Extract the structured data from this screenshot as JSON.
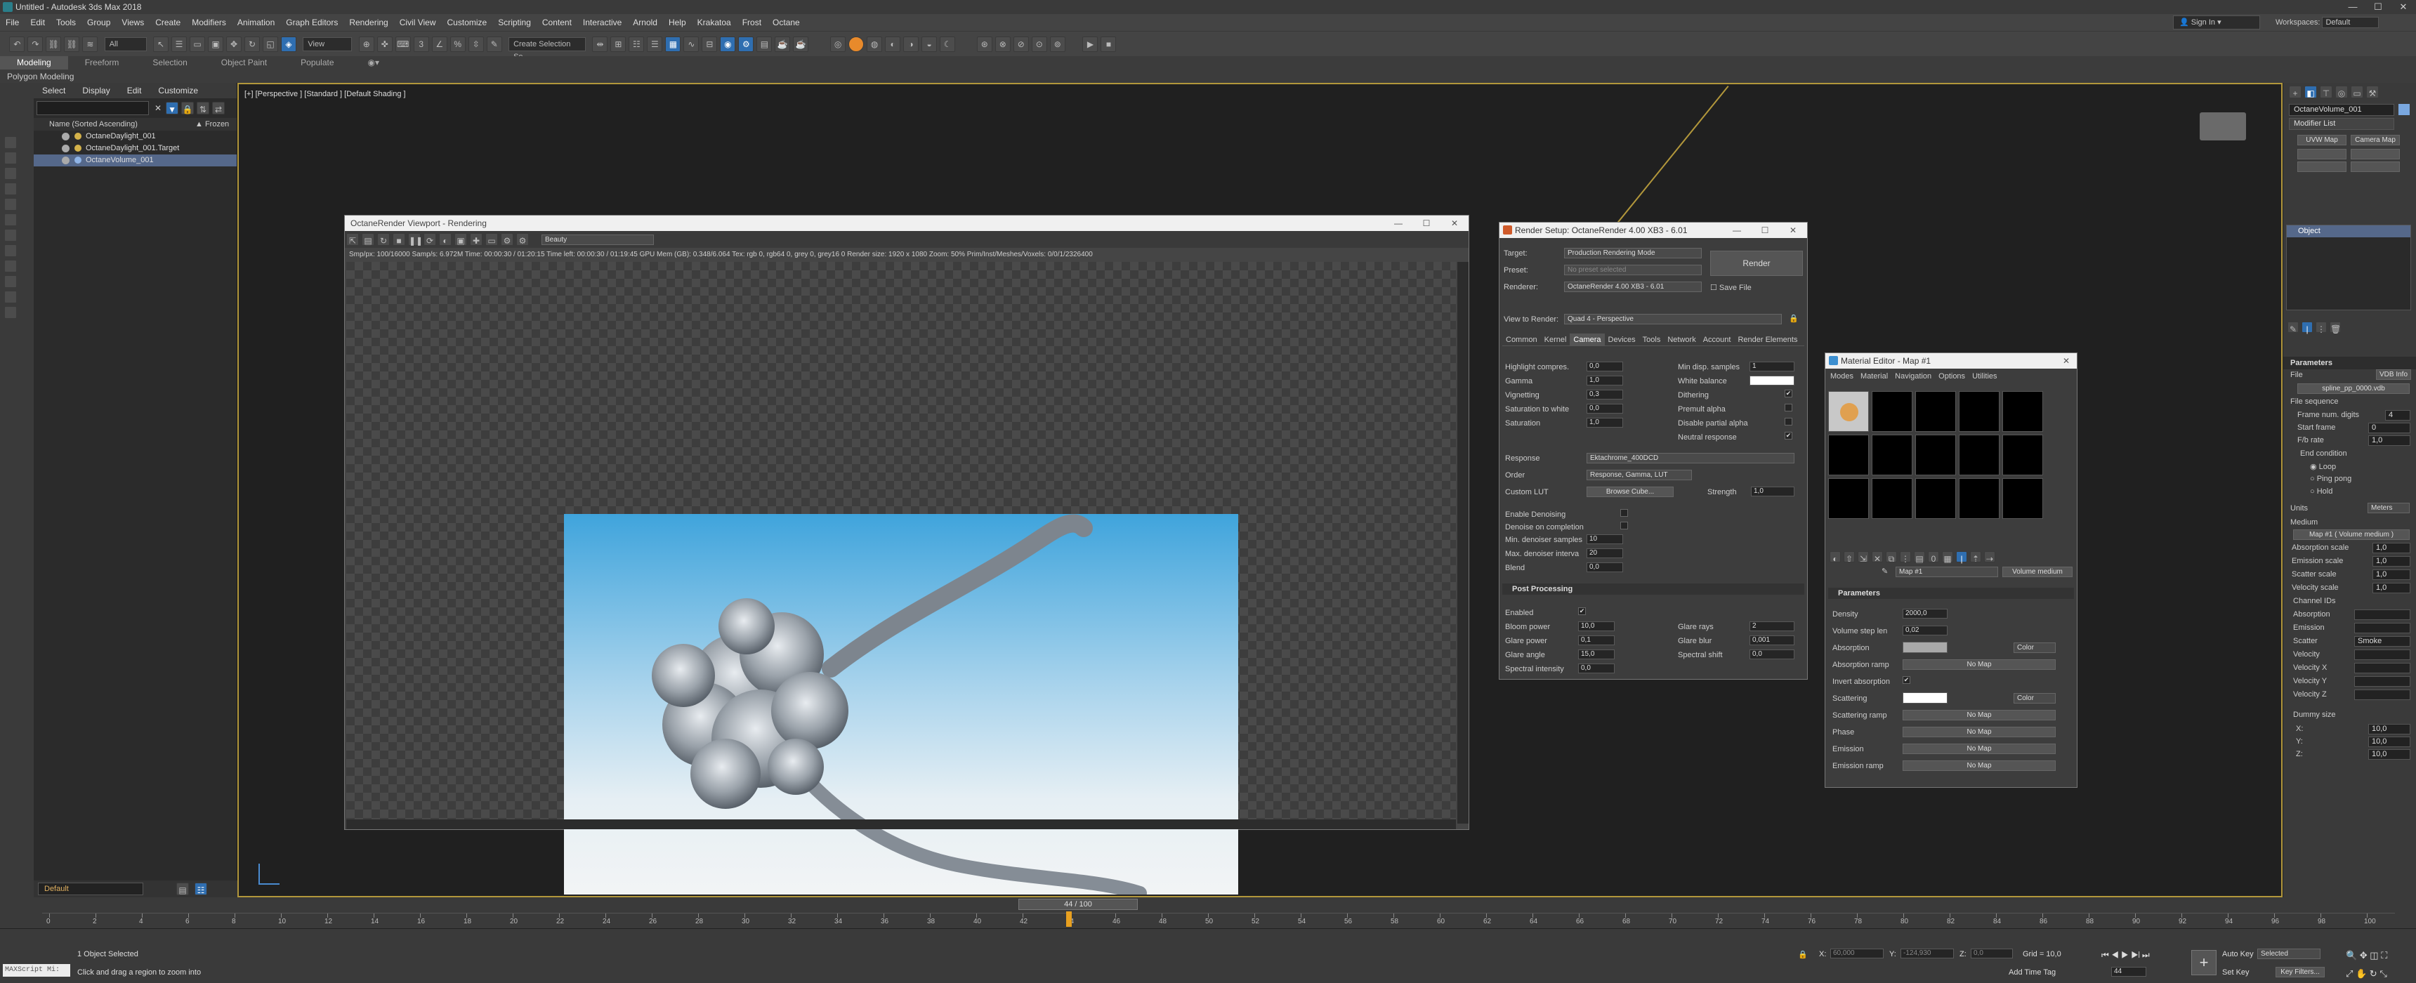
{
  "titlebar": {
    "title": "Untitled - Autodesk 3ds Max 2018",
    "signin": "Sign In",
    "workspace_label": "Workspaces:",
    "workspace": "Default"
  },
  "menus": [
    "File",
    "Edit",
    "Tools",
    "Group",
    "Views",
    "Create",
    "Modifiers",
    "Animation",
    "Graph Editors",
    "Rendering",
    "Civil View",
    "Customize",
    "Scripting",
    "Content",
    "Interactive",
    "Arnold",
    "Help",
    "Krakatoa",
    "Frost",
    "Octane"
  ],
  "toolbar": {
    "filter": "All",
    "refcoord": "View",
    "selset": "Create Selection Se"
  },
  "ribbon": {
    "tabs": [
      "Modeling",
      "Freeform",
      "Selection",
      "Object Paint",
      "Populate"
    ],
    "sub": "Polygon Modeling"
  },
  "scene_explorer": {
    "tabs": [
      "Select",
      "Display",
      "Edit",
      "Customize"
    ],
    "header": "Name (Sorted Ascending)",
    "frozen": "▲ Frozen",
    "rows": [
      "OctaneDaylight_001",
      "OctaneDaylight_001.Target",
      "OctaneVolume_001"
    ],
    "layer": "Default"
  },
  "viewport": {
    "label": "[+] [Perspective ] [Standard ] [Default Shading ]"
  },
  "octane_viewport": {
    "title": "OctaneRender Viewport - Rendering",
    "pass": "Beauty",
    "stats": "Smp/px: 100/16000   Samp/s: 6.972M   Time: 00:00:30 / 01:20:15   Time left: 00:00:30 / 01:19:45   GPU Mem (GB): 0.348/6.064   Tex: rgb 0, rgb64 0, grey 0, grey16 0   Render size: 1920 x 1080   Zoom: 50%   Prim/Inst/Meshes/Voxels: 0/0/1/2326400"
  },
  "render_setup": {
    "title": "Render Setup: OctaneRender 4.00 XB3 - 6.01",
    "target_label": "Target:",
    "target": "Production Rendering Mode",
    "preset_label": "Preset:",
    "preset": "No preset selected",
    "renderer_label": "Renderer:",
    "renderer": "OctaneRender 4.00 XB3 - 6.01",
    "save_file": "Save File",
    "view_label": "View to Render:",
    "view": "Quad 4 - Perspective",
    "render_btn": "Render",
    "tabs": [
      "Common",
      "Kernel",
      "Camera",
      "Devices",
      "Tools",
      "Network",
      "Account",
      "Render Elements"
    ],
    "left_fields": [
      {
        "l": "Highlight compres.",
        "v": "0,0"
      },
      {
        "l": "Gamma",
        "v": "1,0"
      },
      {
        "l": "Vignetting",
        "v": "0,3"
      },
      {
        "l": "Saturation to white",
        "v": "0,0"
      },
      {
        "l": "Saturation",
        "v": "1,0"
      }
    ],
    "right_fields": [
      {
        "l": "Min disp. samples",
        "v": "1"
      },
      {
        "l": "White balance",
        "v": ""
      },
      {
        "l": "Dithering",
        "v": "✔"
      },
      {
        "l": "Premult alpha",
        "v": ""
      },
      {
        "l": "Disable partial alpha",
        "v": ""
      },
      {
        "l": "Neutral response",
        "v": "✔"
      }
    ],
    "response_label": "Response",
    "response": "Ektachrome_400DCD",
    "order_label": "Order",
    "order": "Response, Gamma, LUT",
    "lut_label": "Custom LUT",
    "lut_btn": "Browse Cube...",
    "strength_label": "Strength",
    "strength": "1,0",
    "denoise": [
      {
        "l": "Enable Denoising",
        "v": ""
      },
      {
        "l": "Denoise on completion",
        "v": ""
      },
      {
        "l": "Min. denoiser samples",
        "v": "10"
      },
      {
        "l": "Max. denoiser interva",
        "v": "20"
      },
      {
        "l": "Blend",
        "v": "0,0"
      }
    ],
    "post_title": "Post Processing",
    "post_left": [
      {
        "l": "Enabled",
        "v": "✔"
      },
      {
        "l": "Bloom power",
        "v": "10,0"
      },
      {
        "l": "Glare power",
        "v": "0,1"
      },
      {
        "l": "Glare angle",
        "v": "15,0"
      },
      {
        "l": "Spectral intensity",
        "v": "0,0"
      }
    ],
    "post_right": [
      {
        "l": "Glare rays",
        "v": "2"
      },
      {
        "l": "Glare blur",
        "v": "0,001"
      },
      {
        "l": "Spectral shift",
        "v": "0,0"
      }
    ]
  },
  "material_editor": {
    "title": "Material Editor - Map #1",
    "menus": [
      "Modes",
      "Material",
      "Navigation",
      "Options",
      "Utilities"
    ],
    "map_name": "Map #1",
    "map_type": "Volume medium",
    "params_title": "Parameters",
    "density_label": "Density",
    "density": "2000,0",
    "step_label": "Volume step len",
    "step": "0,02",
    "absorption_label": "Absorption",
    "absorption_mode": "Color",
    "absorption_ramp_label": "Absorption ramp",
    "nomap": "No Map",
    "invert_label": "Invert absorption",
    "scattering_label": "Scattering",
    "scattering_mode": "Color",
    "scattering_ramp_label": "Scattering ramp",
    "phase_label": "Phase",
    "emission_label": "Emission",
    "emission_ramp_label": "Emission ramp"
  },
  "command_panel": {
    "object_name": "OctaneVolume_001",
    "modifier_list": "Modifier List",
    "uvw": "UVW Map",
    "camera_map": "Camera Map",
    "stack_item": "Object",
    "params": "Parameters",
    "file_label": "File",
    "vdb_btn": "VDB Info",
    "file": "spline_pp_0000.vdb",
    "file_seq": "File sequence",
    "frame_digits_label": "Frame num. digits",
    "frame_digits": "4",
    "start_frame_label": "Start frame",
    "start_frame": "0",
    "fps_label": "F/b rate",
    "fps": "1,0",
    "end_cond": "End condition",
    "loop": "Loop",
    "ping": "Ping pong",
    "hold": "Hold",
    "units_label": "Units",
    "units": "Meters",
    "medium_label": "Medium",
    "medium": "Map #1  ( Volume medium )",
    "scales": [
      {
        "l": "Absorption scale",
        "v": "1,0"
      },
      {
        "l": "Emission scale",
        "v": "1,0"
      },
      {
        "l": "Scatter scale",
        "v": "1,0"
      },
      {
        "l": "Velocity scale",
        "v": "1,0"
      }
    ],
    "channel_ids": "Channel IDs",
    "channels": [
      {
        "l": "Absorption",
        "v": ""
      },
      {
        "l": "Emission",
        "v": ""
      },
      {
        "l": "Scatter",
        "v": "Smoke"
      },
      {
        "l": "Velocity",
        "v": ""
      },
      {
        "l": "Velocity X",
        "v": ""
      },
      {
        "l": "Velocity Y",
        "v": ""
      },
      {
        "l": "Velocity Z",
        "v": ""
      }
    ],
    "dummy": "Dummy size",
    "dummy_xyz": [
      {
        "l": "X:",
        "v": "10,0"
      },
      {
        "l": "Y:",
        "v": "10,0"
      },
      {
        "l": "Z:",
        "v": "10,0"
      }
    ]
  },
  "timeline": {
    "frame": "44 / 100",
    "current": 44,
    "max": 100,
    "labels": [
      "0",
      "2",
      "4",
      "6",
      "8",
      "10",
      "12",
      "14",
      "16",
      "18",
      "20",
      "22",
      "24",
      "26",
      "28",
      "30",
      "32",
      "34",
      "36",
      "38",
      "40",
      "42",
      "44",
      "46",
      "48",
      "50",
      "52",
      "54",
      "56",
      "58",
      "60",
      "62",
      "64",
      "66",
      "68",
      "70",
      "72",
      "74",
      "76",
      "78",
      "80",
      "82",
      "84",
      "86",
      "88",
      "90",
      "92",
      "94",
      "96",
      "98",
      "100"
    ]
  },
  "status": {
    "maxscript": "MAXScript Mi:",
    "selected": "1 Object Selected",
    "hint": "Click and drag a region to zoom into",
    "x_label": "X:",
    "x": "60,000",
    "y_label": "Y:",
    "y": "-124,930",
    "z_label": "Z:",
    "z": "0,0",
    "grid": "Grid = 10,0",
    "add_tag": "Add Time Tag",
    "autokey": "Auto Key",
    "selected_dd": "Selected",
    "setkey": "Set Key",
    "keyfilters": "Key Filters...",
    "frame_field": "44"
  }
}
